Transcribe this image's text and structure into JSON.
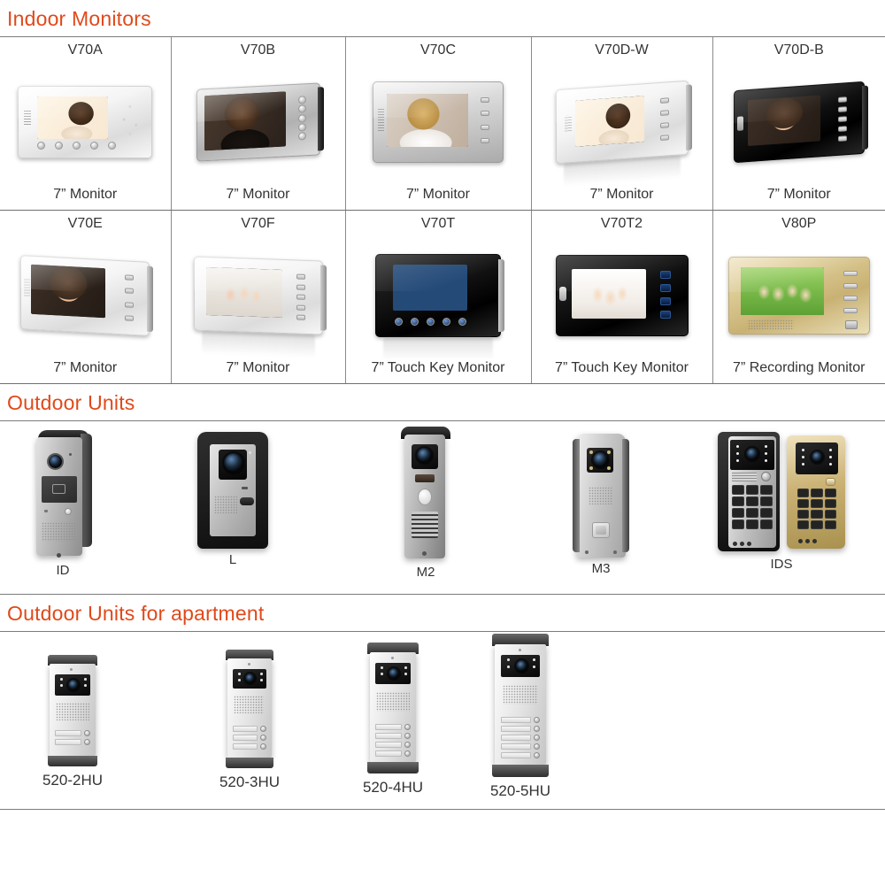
{
  "page": {
    "accent_color": "#E0491A",
    "text_color": "#333333",
    "rule_color": "#7C7C7C"
  },
  "sections": [
    {
      "id": "indoor-monitors",
      "title": "Indoor Monitors",
      "rows": [
        {
          "items": [
            {
              "name": "V70A",
              "caption": "7” Monitor"
            },
            {
              "name": "V70B",
              "caption": "7” Monitor"
            },
            {
              "name": "V70C",
              "caption": "7” Monitor"
            },
            {
              "name": "V70D-W",
              "caption": "7” Monitor"
            },
            {
              "name": "V70D-B",
              "caption": "7” Monitor"
            }
          ]
        },
        {
          "items": [
            {
              "name": "V70E",
              "caption": "7” Monitor"
            },
            {
              "name": "V70F",
              "caption": "7” Monitor"
            },
            {
              "name": "V70T",
              "caption": "7” Touch Key Monitor"
            },
            {
              "name": "V70T2",
              "caption": "7” Touch Key Monitor"
            },
            {
              "name": "V80P",
              "caption": "7” Recording Monitor"
            }
          ]
        }
      ]
    },
    {
      "id": "outdoor-units",
      "title": "Outdoor Units",
      "items": [
        {
          "name": "ID"
        },
        {
          "name": "L"
        },
        {
          "name": "M2"
        },
        {
          "name": "M3"
        },
        {
          "name": "IDS"
        }
      ]
    },
    {
      "id": "outdoor-units-apartment",
      "title": "Outdoor Units for apartment",
      "items": [
        {
          "name": "520-2HU",
          "buttons": 2
        },
        {
          "name": "520-3HU",
          "buttons": 3
        },
        {
          "name": "520-4HU",
          "buttons": 4
        },
        {
          "name": "520-5HU",
          "buttons": 5
        }
      ]
    }
  ]
}
